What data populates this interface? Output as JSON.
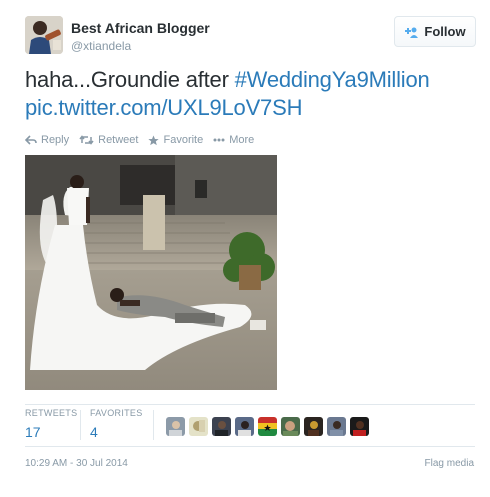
{
  "author": {
    "name": "Best African Blogger",
    "handle": "@xtiandela"
  },
  "follow_button": {
    "label": "Follow"
  },
  "tweet": {
    "text_prefix": "haha...Groundie after ",
    "hashtag": "#WeddingYa9Million",
    "link": "pic.twitter.com/UXL9LoV7SH"
  },
  "actions": {
    "reply": "Reply",
    "retweet": "Retweet",
    "favorite": "Favorite",
    "more": "More"
  },
  "stats": {
    "retweets_label": "RETWEETS",
    "retweets_count": "17",
    "favorites_label": "FAVORITES",
    "favorites_count": "4"
  },
  "favoriter_count_shown": 9,
  "timestamp": "10:29 AM - 30 Jul 2014",
  "flag_media": "Flag media",
  "colors": {
    "link": "#2b7bb9",
    "text": "#292f33",
    "muted": "#8899a6",
    "border": "#e1e8ed"
  }
}
